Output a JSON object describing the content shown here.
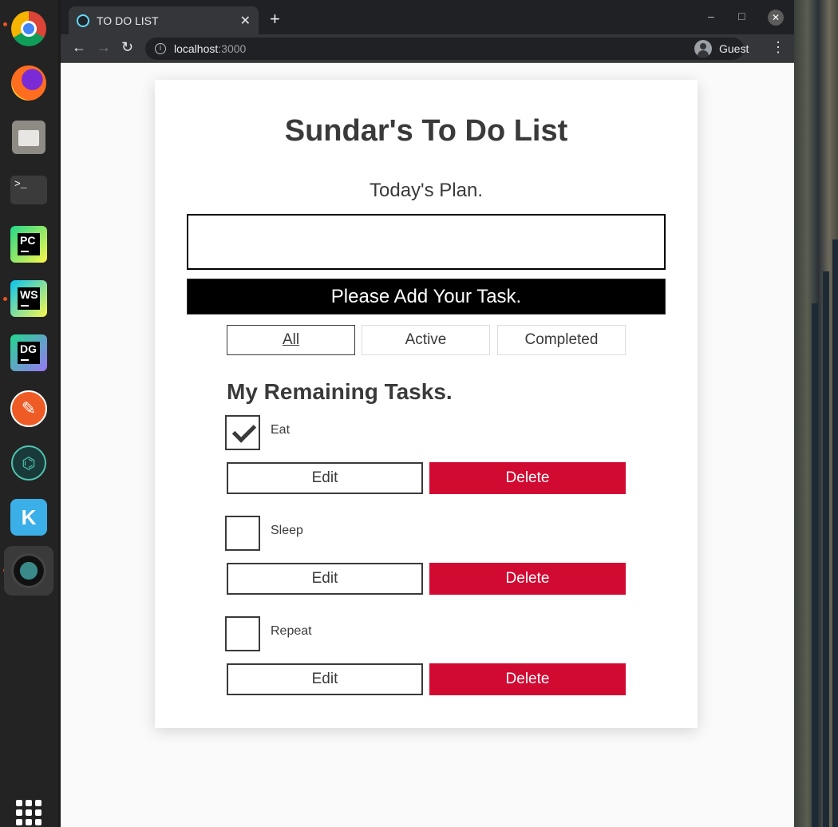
{
  "browser": {
    "tab_title": "TO DO LIST",
    "tab_close": "✕",
    "new_tab": "+",
    "url_host": "localhost",
    "url_port": ":3000",
    "profile_name": "Guest"
  },
  "app": {
    "title": "Sundar's To Do List",
    "plan_label": "Today's Plan.",
    "input_value": "",
    "add_button": "Please Add Your Task.",
    "filters": [
      "All",
      "Active",
      "Completed"
    ],
    "active_filter": "All",
    "tasks_heading": "My Remaining Tasks.",
    "tasks": [
      {
        "name": "Eat",
        "checked": true,
        "edit_label": "Edit",
        "delete_label": "Delete"
      },
      {
        "name": "Sleep",
        "checked": false,
        "edit_label": "Edit",
        "delete_label": "Delete"
      },
      {
        "name": "Repeat",
        "checked": false,
        "edit_label": "Edit",
        "delete_label": "Delete"
      }
    ]
  },
  "colors": {
    "delete": "#d10a32",
    "add_button_bg": "#000000",
    "text": "#3a3a3a"
  }
}
